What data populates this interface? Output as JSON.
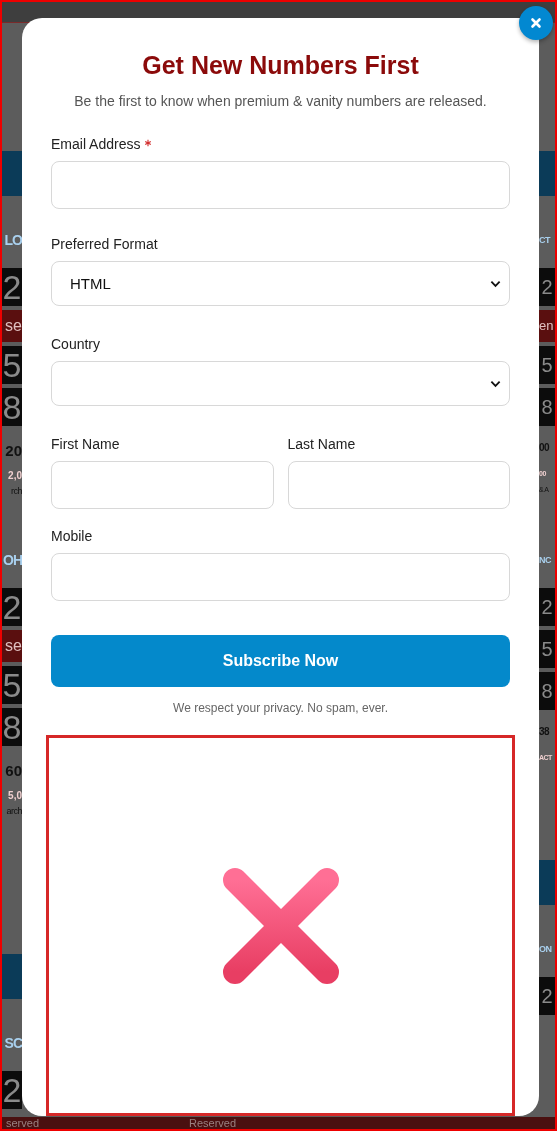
{
  "background": {
    "left_strip": [
      {
        "kind": "header"
      },
      {
        "kind": "label",
        "text": "LO"
      },
      {
        "kind": "tile",
        "text": "2"
      },
      {
        "kind": "band",
        "text": "se"
      },
      {
        "kind": "tile",
        "text": "5"
      },
      {
        "kind": "tile",
        "text": "8"
      },
      {
        "kind": "value",
        "text": "20"
      },
      {
        "kind": "price",
        "text": "2,0"
      },
      {
        "kind": "note",
        "text": "rch"
      },
      {
        "kind": "label",
        "text": "OH"
      },
      {
        "kind": "tile",
        "text": "2"
      },
      {
        "kind": "band",
        "text": "se"
      },
      {
        "kind": "tile",
        "text": "5"
      },
      {
        "kind": "tile",
        "text": "8"
      },
      {
        "kind": "value",
        "text": "60"
      },
      {
        "kind": "price",
        "text": "5,0"
      },
      {
        "kind": "note",
        "text": "arch"
      },
      {
        "kind": "header"
      },
      {
        "kind": "label",
        "text": "SC"
      },
      {
        "kind": "tile",
        "text": "2"
      }
    ],
    "right_strip": [
      {
        "kind": "header"
      },
      {
        "kind": "label",
        "text": "CT"
      },
      {
        "kind": "tile",
        "text": "2"
      },
      {
        "kind": "band",
        "text": "en"
      },
      {
        "kind": "tile",
        "text": "5"
      },
      {
        "kind": "tile",
        "text": "8"
      },
      {
        "kind": "value",
        "text": "00"
      },
      {
        "kind": "price",
        "text": "00"
      },
      {
        "kind": "note",
        "text": "& A"
      },
      {
        "kind": "label",
        "text": "NC"
      },
      {
        "kind": "tile",
        "text": "2"
      },
      {
        "kind": "tile",
        "text": "5"
      },
      {
        "kind": "tile",
        "text": "8"
      },
      {
        "kind": "value",
        "text": "38"
      },
      {
        "kind": "price",
        "text": "ACT"
      },
      {
        "kind": "header"
      },
      {
        "kind": "label",
        "text": "ON"
      },
      {
        "kind": "tile",
        "text": "2"
      }
    ],
    "bottom_band": [
      "served",
      "Reserved"
    ]
  },
  "modal": {
    "title": "Get New Numbers First",
    "subtitle": "Be the first to know when premium & vanity numbers are released.",
    "fields": [
      {
        "kind": "text",
        "label": "Email Address",
        "required": true
      },
      {
        "kind": "select",
        "label": "Preferred Format",
        "value": "HTML"
      },
      {
        "kind": "select",
        "label": "Country"
      },
      {
        "kind": "pair",
        "items": [
          {
            "label": "First Name"
          },
          {
            "label": "Last Name"
          }
        ]
      },
      {
        "kind": "text",
        "label": "Mobile",
        "required": false
      }
    ],
    "button": "Subscribe Now",
    "privacy_note": "We respect your privacy. No spam, ever.",
    "image": {
      "kind": "broken"
    }
  }
}
